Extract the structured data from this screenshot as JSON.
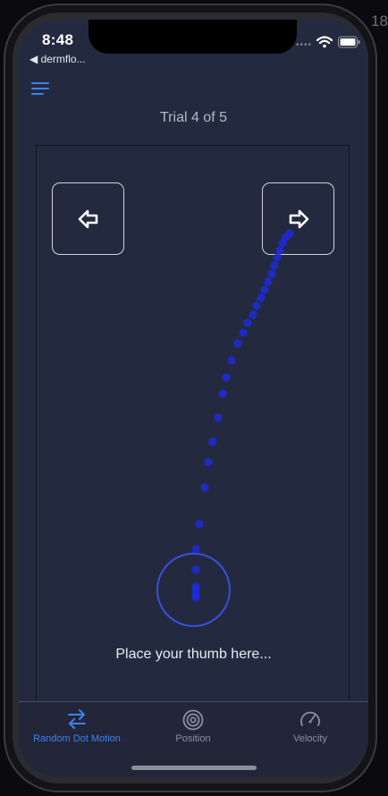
{
  "status_bar": {
    "time": "8:48",
    "back_label": "◀ dermflo...",
    "signal_dots": "••••",
    "wifi_icon": "wifi-icon",
    "battery_icon": "battery-icon"
  },
  "side_text": "18",
  "header": {
    "menu_icon": "hamburger-menu-icon",
    "trial_label": "Trial 4 of 5"
  },
  "task": {
    "left_icon": "arrow-left-icon",
    "right_icon": "arrow-right-icon",
    "thumb_prompt": "Place your thumb here..."
  },
  "tabs": [
    {
      "label": "Random Dot Motion",
      "icon": "swap-arrows-icon",
      "active": true
    },
    {
      "label": "Position",
      "icon": "target-icon",
      "active": false
    },
    {
      "label": "Velocity",
      "icon": "speedometer-icon",
      "active": false
    }
  ],
  "colors": {
    "background": "#232a40",
    "accent": "#3f82f0",
    "trace_dot": "#1d2ad8",
    "target_ring": "#3850dc"
  }
}
